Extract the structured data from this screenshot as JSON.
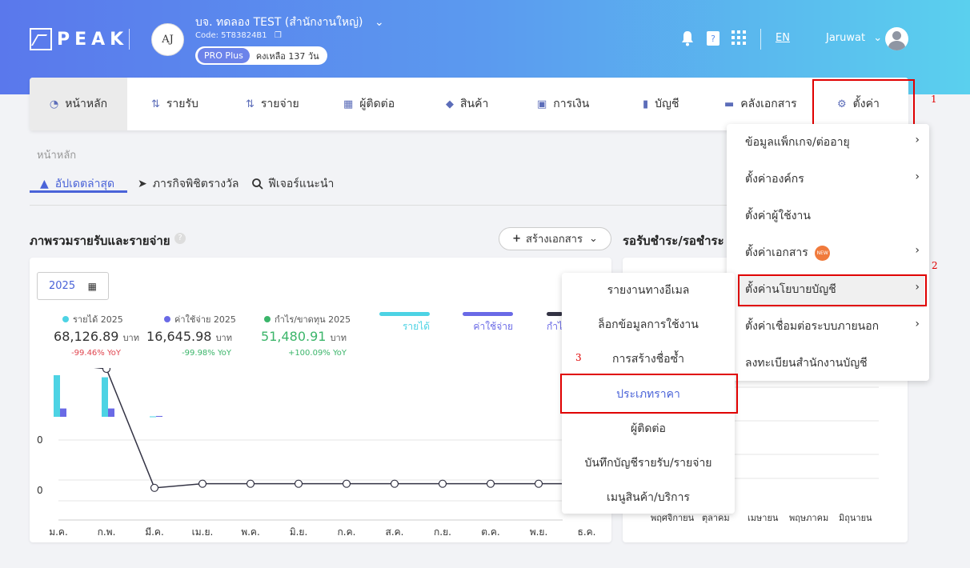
{
  "header": {
    "logo_text": "PEAK",
    "company_name": "บจ. ทดลอง TEST (สำนักงานใหญ่)",
    "company_code": "Code: 5T83824B1",
    "plan_name": "PRO Plus",
    "plan_remaining": "คงเหลือ 137 วัน",
    "company_avatar_text": "AJ",
    "language": "EN",
    "user_name": "Jaruwat"
  },
  "nav": {
    "items": [
      {
        "label": "หน้าหลัก",
        "icon": "dashboard-icon"
      },
      {
        "label": "รายรับ",
        "icon": "income-icon"
      },
      {
        "label": "รายจ่าย",
        "icon": "expense-icon"
      },
      {
        "label": "ผู้ติดต่อ",
        "icon": "contacts-icon"
      },
      {
        "label": "สินค้า",
        "icon": "product-icon"
      },
      {
        "label": "การเงิน",
        "icon": "money-icon"
      },
      {
        "label": "บัญชี",
        "icon": "book-icon"
      },
      {
        "label": "คลังเอกสาร",
        "icon": "folder-icon"
      },
      {
        "label": "ตั้งค่า",
        "icon": "gear-icon"
      }
    ]
  },
  "annotations": {
    "n1": "1",
    "n2": "2",
    "n3": "3"
  },
  "breadcrumb": "หน้าหลัก",
  "tabs": {
    "updates": "อัปเดตล่าสุด",
    "missions": "ภารกิจพิชิตรางวัล",
    "features": "ฟีเจอร์แนะนำ"
  },
  "overview": {
    "title": "ภาพรวมรายรับและรายจ่าย",
    "create_button": "สร้างเอกสาร",
    "year": "2025",
    "stats": [
      {
        "label": "รายได้ 2025",
        "value": "68,126.89",
        "unit": "บาท",
        "yoy": "-99.46% YoY",
        "color": "#4dd3e4",
        "yoy_color": "#e0454f"
      },
      {
        "label": "ค่าใช้จ่าย 2025",
        "value": "16,645.98",
        "unit": "บาท",
        "yoy": "-99.98% YoY",
        "color": "#6a6ae6",
        "yoy_color": "#3bb56a"
      },
      {
        "label": "กำไร/ขาดทุน 2025",
        "value": "51,480.91",
        "unit": "บาท",
        "yoy": "+100.09% YoY",
        "color": "#3bb56a",
        "yoy_color": "#3bb56a"
      }
    ],
    "legend": [
      {
        "label": "รายได้",
        "color": "#4dd3e4"
      },
      {
        "label": "ค่าใช้จ่าย",
        "color": "#6a6ae6"
      },
      {
        "label": "กำไ",
        "color": "#333344"
      }
    ],
    "axis_zero": "0",
    "axis_zero2": "0",
    "months": [
      "ม.ค.",
      "ก.พ.",
      "มี.ค.",
      "เม.ย.",
      "พ.ค.",
      "มิ.ย.",
      "ก.ค.",
      "ส.ค.",
      "ก.ย.",
      "ต.ค.",
      "พ.ย.",
      "ธ.ค."
    ]
  },
  "receivables": {
    "title": "รอรับชำระ/รอชำระ",
    "months": [
      "พฤศจิกายน",
      "ตุลาคม",
      "เมษายน",
      "พฤษภาคม",
      "มิถุนายน"
    ]
  },
  "settings_menu": {
    "items": [
      {
        "label": "ข้อมูลแพ็กเกจ/ต่ออายุ",
        "chevron": true
      },
      {
        "label": "ตั้งค่าองค์กร",
        "chevron": true
      },
      {
        "label": "ตั้งค่าผู้ใช้งาน",
        "chevron": false
      },
      {
        "label": "ตั้งค่าเอกสาร",
        "chevron": true,
        "badge": "NEW"
      },
      {
        "label": "ตั้งค่านโยบายบัญชี",
        "chevron": true
      },
      {
        "label": "ตั้งค่าเชื่อมต่อระบบภายนอก",
        "chevron": true
      },
      {
        "label": "ลงทะเบียนสำนักงานบัญชี",
        "chevron": false
      }
    ]
  },
  "policy_submenu": {
    "items": [
      "รายงานทางอีเมล",
      "ล็อกข้อมูลการใช้งาน",
      "การสร้างชื่อซ้ำ",
      "ประเภทราคา",
      "ผู้ติดต่อ",
      "บันทึกบัญชีรายรับ/รายจ่าย",
      "เมนูสินค้า/บริการ"
    ]
  },
  "chart_data": {
    "type": "bar",
    "categories": [
      "ม.ค.",
      "ก.พ.",
      "มี.ค.",
      "เม.ย.",
      "พ.ค.",
      "มิ.ย.",
      "ก.ค.",
      "ส.ค.",
      "ก.ย.",
      "ต.ค.",
      "พ.ย.",
      "ธ.ค."
    ],
    "series": [
      {
        "name": "รายได้",
        "values": [
          1.0,
          0.95,
          0.01,
          0,
          0,
          0,
          0,
          0,
          0,
          0,
          0,
          0
        ]
      },
      {
        "name": "ค่าใช้จ่าย",
        "values": [
          0.2,
          0.2,
          0.02,
          0,
          0,
          0,
          0,
          0,
          0,
          0,
          0,
          0
        ]
      },
      {
        "name": "กำไ",
        "values": [
          0.8,
          0.76,
          -0.11,
          -0.08,
          -0.08,
          -0.08,
          -0.08,
          -0.08,
          -0.08,
          -0.08,
          -0.08,
          -0.08
        ]
      }
    ]
  }
}
